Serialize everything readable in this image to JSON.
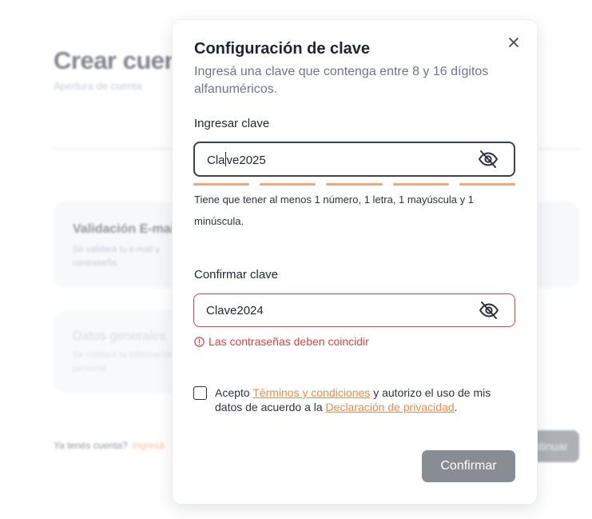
{
  "background": {
    "title": "Crear cuenta",
    "subtitle": "Apertura de cuenta",
    "card1_title": "Validación E-mail",
    "card1_text": "Se validará tu e-mail y contraseña.",
    "card2_title": "Datos generales",
    "card2_text": "Se validará tu información personal",
    "login_prompt": "Ya tenés cuenta?",
    "login_link": "Ingresá",
    "continue_button": "Continuar"
  },
  "modal": {
    "title": "Configuración de clave",
    "description": "Ingresá una clave que contenga entre 8 y 16 dígitos alfanuméricos.",
    "password_label": "Ingresar clave",
    "password_value_before_caret": "Cla",
    "password_value_after_caret": "ve2025",
    "strength_level": 1.0,
    "hint": "Tiene que tener al menos 1 número, 1 letra, 1 mayúscula y 1 minúscula.",
    "confirm_label": "Confirmar clave",
    "confirm_value": "Clave2024",
    "error_message": "Las contraseñas deben coincidir",
    "terms_prefix": "Acepto",
    "terms_link": "Términos y condiciones",
    "terms_middle": "y autorizo el uso de mis datos de acuerdo a la",
    "privacy_link": "Declaración de privacidad",
    "terms_suffix": ".",
    "confirm_button": "Confirmar"
  },
  "icons": {
    "close": "close-icon",
    "toggle_visibility": "eye-off-icon",
    "error": "info-circle-icon"
  },
  "colors": {
    "accent": "#f08a4b",
    "error": "#e0403f",
    "button_disabled": "#888c93",
    "strength_bar": "#f4a57b"
  }
}
